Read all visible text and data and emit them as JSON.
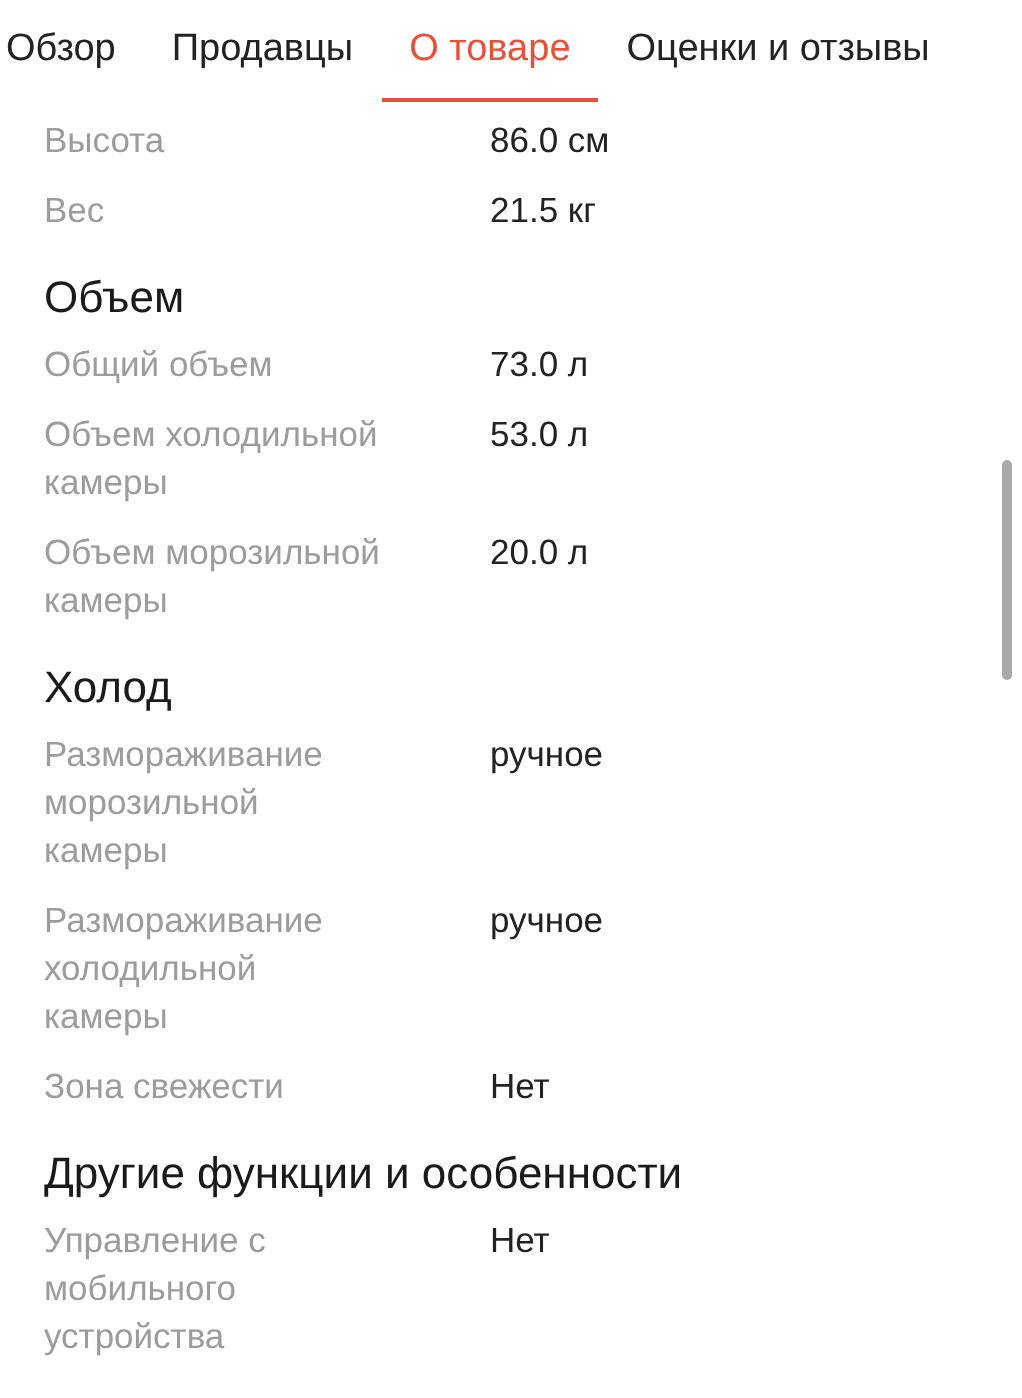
{
  "tabs": [
    {
      "label": "Обзор",
      "selected": false
    },
    {
      "label": "Продавцы",
      "selected": false
    },
    {
      "label": "О товаре",
      "selected": true
    },
    {
      "label": "Оценки и отзывы",
      "selected": false
    }
  ],
  "sections": [
    {
      "rows": [
        {
          "label": "Высота",
          "value": "86.0 см"
        },
        {
          "label": "Вес",
          "value": "21.5 кг"
        }
      ]
    },
    {
      "title": "Объем",
      "rows": [
        {
          "label": "Общий объем",
          "value": "73.0 л"
        },
        {
          "label": "Объем холодильной камеры",
          "value": "53.0 л"
        },
        {
          "label": "Объем морозильной камеры",
          "value": "20.0 л"
        }
      ]
    },
    {
      "title": "Холод",
      "rows": [
        {
          "label": "Размораживание морозильной камеры",
          "value": "ручное"
        },
        {
          "label": "Размораживание холодильной камеры",
          "value": "ручное"
        },
        {
          "label": "Зона свежести",
          "value": "Нет"
        }
      ]
    },
    {
      "title": "Другие функции и особенности",
      "rows": [
        {
          "label": "Управление с мобильного устройства",
          "value": "Нет"
        }
      ]
    }
  ]
}
